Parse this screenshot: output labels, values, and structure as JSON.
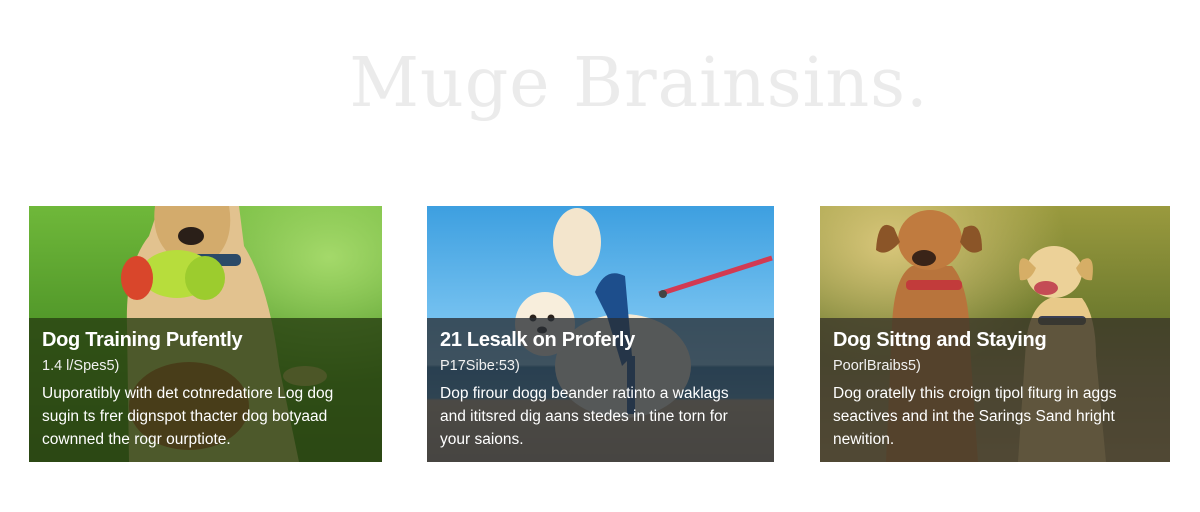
{
  "hero": {
    "title": "Muge Brainsins."
  },
  "cards": [
    {
      "title": "Dog Training Pufently",
      "meta": "1.4 l/Spes5)",
      "desc_lines": [
        "Uuporatibly with det cotnredatiore Log dog",
        "sugin ts frer dignspot thacter dog botyaad",
        "cownned the rogr ourptiote."
      ]
    },
    {
      "title": "21 Lesalk on Proferly",
      "meta": "P17Sibe:53)",
      "desc_lines": [
        "Dop firour dogg beander ratinto a waklags",
        "and ititsred dig aans stedes in tine torn for",
        "your saions."
      ]
    },
    {
      "title": "Dog Sittng and Staying",
      "meta": "PoorlBraibs5)",
      "desc_lines": [
        "Dog oratelly this croign tipol fiturg in aggs",
        "seactives and int the Sarings Sand hright",
        "newition."
      ]
    }
  ],
  "icons": {
    "card1": "puppy-with-toy-photo",
    "card2": "dog-on-leash-beach-photo",
    "card3": "two-dogs-sitting-photo"
  },
  "colors": {
    "hero_text": "#ebebeb",
    "overlay_text": "#ffffff"
  }
}
